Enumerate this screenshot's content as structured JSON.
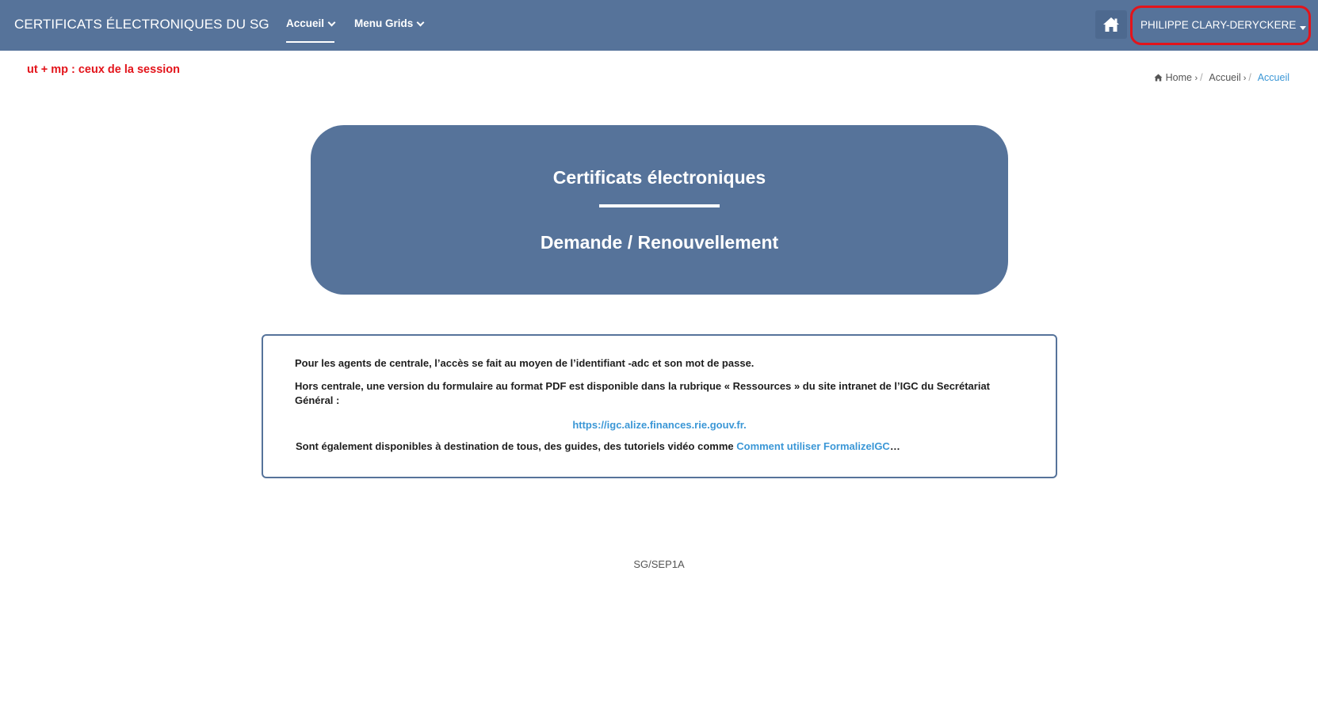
{
  "header": {
    "brand": "CERTIFICATS ÉLECTRONIQUES DU SG",
    "nav": [
      {
        "label": "Accueil",
        "active": true
      },
      {
        "label": "Menu Grids",
        "active": false
      }
    ],
    "home_icon": "home-icon",
    "user_name": "PHILIPPE CLARY-DERYCKERE"
  },
  "session_note": "ut + mp : ceux de la session",
  "breadcrumb": {
    "items": [
      "Home",
      "Accueil",
      "Accueil"
    ]
  },
  "hero": {
    "title": "Certificats électroniques",
    "subtitle": "Demande / Renouvellement"
  },
  "info": {
    "p1": "Pour les agents de centrale, l’accès se fait au moyen de l’identifiant -adc et son mot de passe.",
    "p2": "Hors centrale, une version du formulaire au format PDF est disponible dans la rubrique « Ressources » du site intranet de l’IGC du Secrétariat Général :",
    "url": "https://igc.alize.finances.rie.gouv.fr.",
    "p4_text": "Sont également disponibles à destination de tous, des guides, des tutoriels vidéo comme ",
    "p4_link": "Comment utiliser FormalizeIGC",
    "p4_suffix": "…"
  },
  "footer": "SG/SEP1A",
  "colors": {
    "navbar": "#56739a",
    "accent_link": "#3b97d6",
    "annotation_red": "#e3141b"
  }
}
